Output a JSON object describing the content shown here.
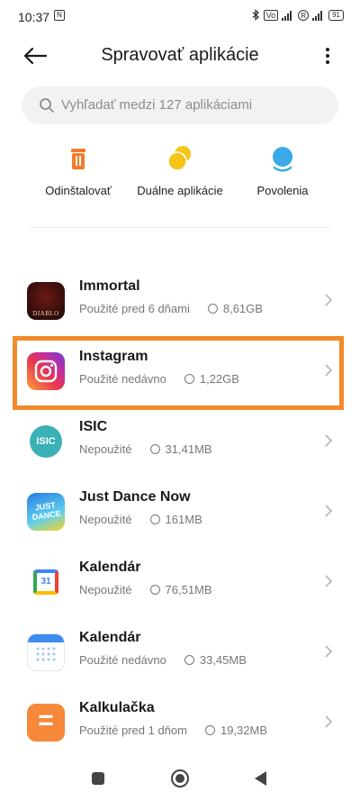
{
  "status_bar": {
    "time": "10:37",
    "volte": "Vo",
    "battery": "91",
    "r_badge": "R"
  },
  "header": {
    "title": "Spravovať aplikácie",
    "back_icon": "arrow-left-icon",
    "more_icon": "more-vertical-icon"
  },
  "search": {
    "placeholder": "Vyhľadať medzi 127 aplikáciami"
  },
  "actions": [
    {
      "label": "Odinštalovať",
      "icon": "trash-icon",
      "color": "#f27c2b"
    },
    {
      "label": "Duálne aplikácie",
      "icon": "dual-apps-icon",
      "color": "#f5c518"
    },
    {
      "label": "Povolenia",
      "icon": "permissions-icon",
      "color": "#3aa9e8"
    }
  ],
  "apps": [
    {
      "name": "Immortal",
      "usage": "Použité pred 6 dňami",
      "size": "8,61GB",
      "icon": "diablo-icon",
      "icon_text": "DIABLO"
    },
    {
      "name": "Instagram",
      "usage": "Použité nedávno",
      "size": "1,22GB",
      "icon": "instagram-icon",
      "highlighted": true
    },
    {
      "name": "ISIC",
      "usage": "Nepoužité",
      "size": "31,41MB",
      "icon": "isic-icon",
      "icon_text": "ISIC"
    },
    {
      "name": "Just Dance Now",
      "usage": "Nepoužité",
      "size": "161MB",
      "icon": "just-dance-icon",
      "icon_text": "JUST DANCE"
    },
    {
      "name": "Kalendár",
      "usage": "Nepoužité",
      "size": "76,51MB",
      "icon": "google-calendar-icon",
      "icon_text": "31"
    },
    {
      "name": "Kalendár",
      "usage": "Použité nedávno",
      "size": "33,45MB",
      "icon": "calendar-icon"
    },
    {
      "name": "Kalkulačka",
      "usage": "Použité pred 1 dňom",
      "size": "19,32MB",
      "icon": "calculator-icon",
      "icon_text": "="
    }
  ],
  "colors": {
    "highlight": "#f28a2b"
  }
}
